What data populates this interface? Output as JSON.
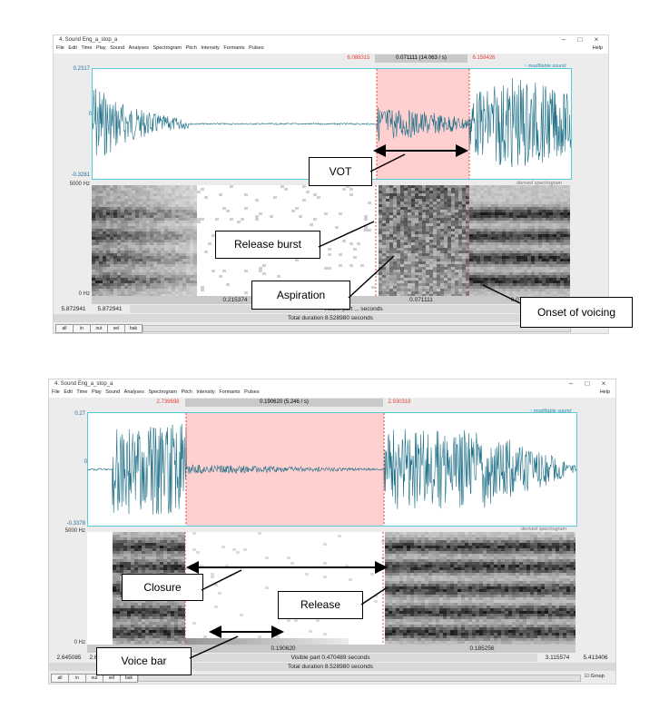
{
  "menu": [
    "File",
    "Edit",
    "Time",
    "Play",
    "Sound",
    "Analyses",
    "Spectrogram",
    "Pitch",
    "Intensity",
    "Formants",
    "Pulses"
  ],
  "help": "Help",
  "win_controls": [
    "–",
    "□",
    "×"
  ],
  "nav_buttons": [
    "all",
    "in",
    "out",
    "sel",
    "bak"
  ],
  "colors": {
    "waveform": "#1e6f86",
    "selection": "#ffd0d0",
    "border": "#58c8dc",
    "marker": "#e8423a"
  },
  "window1": {
    "title": "4. Sound Eng_a_stop_a",
    "sel_start": "6.088315",
    "sel_center": "0.071111 (14.063 / s)",
    "sel_end": "6.159426",
    "y_top": "0.2317",
    "y_mid": "0",
    "y_bot": "-0.3281",
    "legend_wave": "~ modifiable sound",
    "legend_spec": "derived spectrogram",
    "freq_top": "5000 Hz",
    "freq_bot": "0 Hz",
    "seg1": "0.215374",
    "seg2": "0.071111",
    "seg3": "0.07",
    "left_time": "5.872941",
    "left_time_blue": "5.872941",
    "visible_text": "Visible part ... seconds",
    "total": "Total duration 8.528980 seconds",
    "annotations": {
      "vot": "VOT",
      "burst": "Release burst",
      "aspiration": "Aspiration",
      "onset": "Onset of voicing"
    }
  },
  "window2": {
    "title": "4. Sound Eng_a_stop_a",
    "sel_start": "2.739698",
    "sel_center": "0.190620 (5.246 / s)",
    "sel_end": "2.930318",
    "y_top": "0.27",
    "y_mid": "0",
    "y_bot": "-0.3378",
    "legend_wave": "~ modifiable sound",
    "legend_spec": "derived spectrogram",
    "freq_top": "5000 Hz",
    "freq_bot": "0 Hz",
    "seg1": "0.190620",
    "seg2": "0.185256",
    "left_time": "2.645085",
    "left_time_blue": "2.6",
    "right_time_blue": "3.115574",
    "right_time": "5.413406",
    "visible_text": "Visible part 0.470489 seconds",
    "total": "Total duration 8.528980 seconds",
    "group": "Group",
    "annotations": {
      "closure": "Closure",
      "release": "Release",
      "voicebar": "Voice bar"
    }
  }
}
